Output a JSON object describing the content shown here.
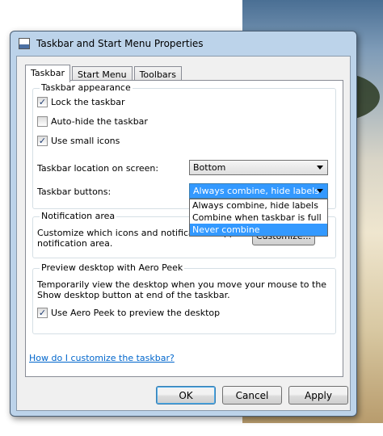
{
  "window": {
    "title": "Taskbar and Start Menu Properties"
  },
  "tabs": [
    {
      "label": "Taskbar",
      "active": true
    },
    {
      "label": "Start Menu",
      "active": false
    },
    {
      "label": "Toolbars",
      "active": false
    }
  ],
  "appearance": {
    "title": "Taskbar appearance",
    "checkboxes": [
      {
        "label": "Lock the taskbar",
        "checked": true
      },
      {
        "label": "Auto-hide the taskbar",
        "checked": false
      },
      {
        "label": "Use small icons",
        "checked": true
      }
    ],
    "location_label": "Taskbar location on screen:",
    "location_value": "Bottom",
    "buttons_label": "Taskbar buttons:",
    "buttons_value": "Always combine, hide labels",
    "buttons_options": [
      "Always combine, hide labels",
      "Combine when taskbar is full",
      "Never combine"
    ],
    "buttons_highlighted": "Never combine"
  },
  "notification": {
    "title": "Notification area",
    "description_line1": "Customize which icons and notifications appear in the",
    "description_line2": "notification area.",
    "customize_label": "Customize..."
  },
  "aero_peek": {
    "title": "Preview desktop with Aero Peek",
    "description_line1": "Temporarily view the desktop when you move your mouse to the",
    "description_line2": "Show desktop button at end of the taskbar.",
    "checkbox_label": "Use Aero Peek to preview the desktop",
    "checked": true
  },
  "help_link": "How do I customize the taskbar?",
  "footer": {
    "ok": "OK",
    "cancel": "Cancel",
    "apply": "Apply"
  },
  "glyphs": {
    "check": "✓"
  }
}
